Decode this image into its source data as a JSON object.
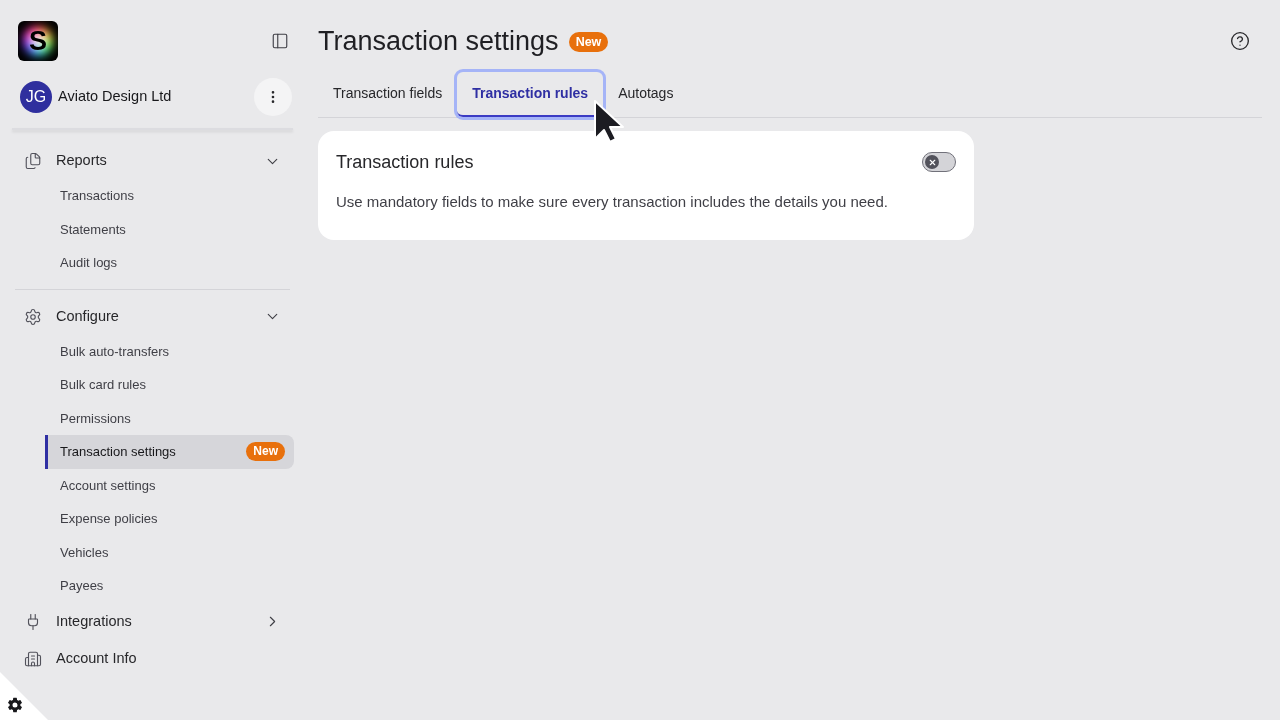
{
  "sidebar": {
    "logo": {
      "letter": "S"
    },
    "account": {
      "initials": "JG",
      "name": "Aviato Design Ltd"
    },
    "nav_groups": [
      {
        "entries": [
          {
            "kind": "section",
            "label": "Reports",
            "expanded": true,
            "items": [
              {
                "label": "Transactions",
                "selected": false
              },
              {
                "label": "Statements",
                "selected": false
              },
              {
                "label": "Audit logs",
                "selected": false
              }
            ]
          }
        ]
      },
      {
        "entries": [
          {
            "kind": "section",
            "label": "Configure",
            "expanded": true,
            "items": [
              {
                "label": "Bulk auto-transfers",
                "selected": false
              },
              {
                "label": "Bulk card rules",
                "selected": false
              },
              {
                "label": "Permissions",
                "selected": false
              },
              {
                "label": "Transaction settings",
                "selected": true,
                "badge": "New"
              },
              {
                "label": "Account settings",
                "selected": false
              },
              {
                "label": "Expense policies",
                "selected": false
              },
              {
                "label": "Vehicles",
                "selected": false
              },
              {
                "label": "Payees",
                "selected": false
              }
            ]
          },
          {
            "kind": "section",
            "label": "Integrations",
            "expanded": false
          },
          {
            "kind": "link",
            "label": "Account Info"
          }
        ]
      }
    ]
  },
  "page": {
    "title": "Transaction settings",
    "badge": "New"
  },
  "tabs": [
    {
      "label": "Transaction fields",
      "selected": false,
      "focused": false
    },
    {
      "label": "Transaction rules",
      "selected": true,
      "focused": true
    },
    {
      "label": "Autotags",
      "selected": false,
      "focused": false
    }
  ],
  "card": {
    "title": "Transaction rules",
    "toggle": {
      "on": false
    },
    "description": "Use mandatory fields to make sure every transaction includes the details you need."
  }
}
